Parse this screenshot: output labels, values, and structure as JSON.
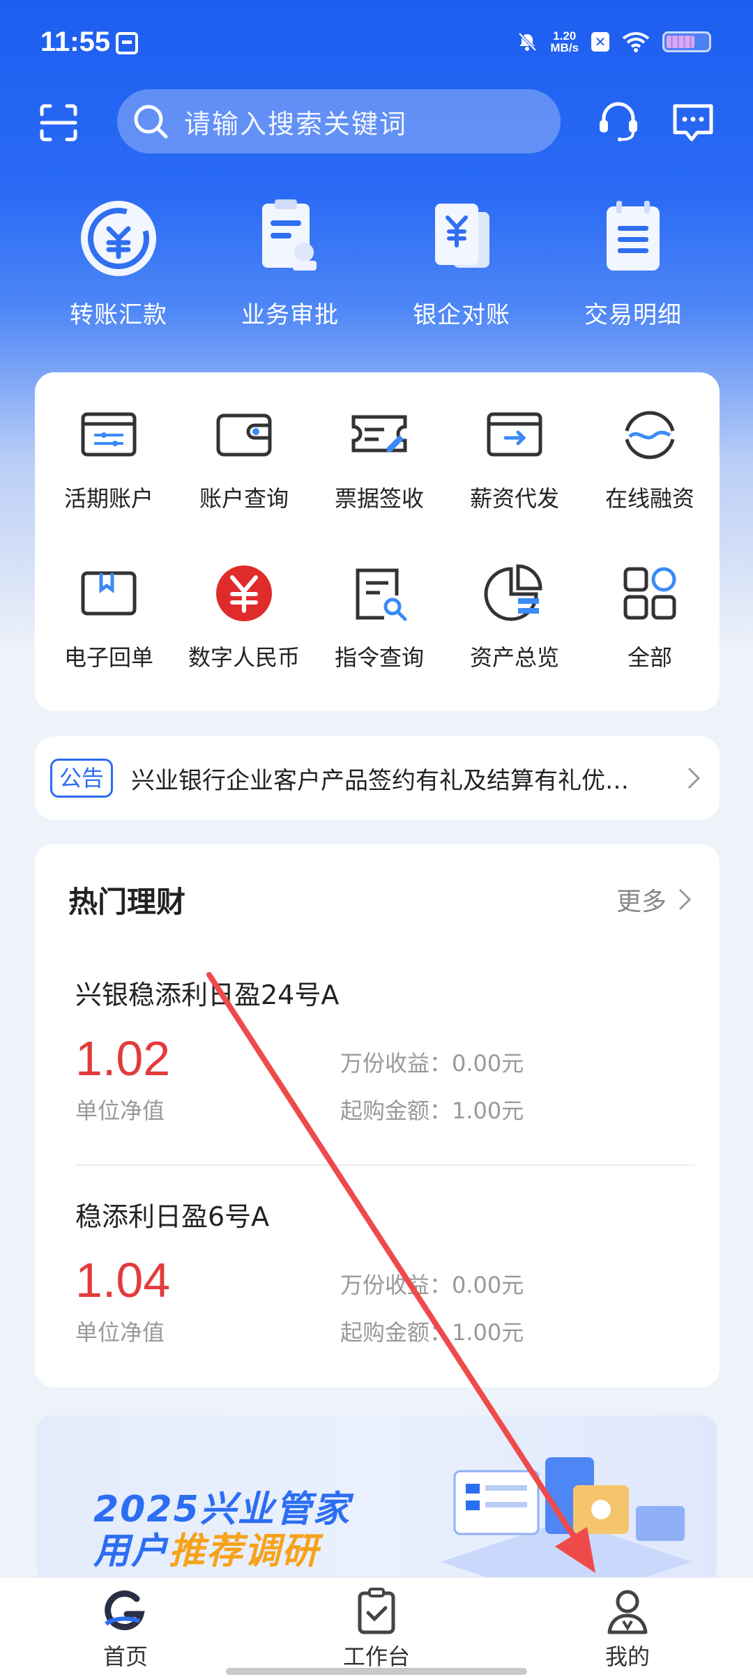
{
  "status_bar": {
    "time": "11:55",
    "net_speed_value": "1.20",
    "net_speed_unit": "MB/s",
    "icons": [
      "sim-card-icon",
      "mute-bell-icon",
      "x-app-icon",
      "wifi-icon",
      "battery-icon"
    ]
  },
  "header": {
    "search_placeholder": "请输入搜索关键词",
    "icons": [
      "scan-icon",
      "search-icon",
      "customer-service-icon",
      "message-icon"
    ]
  },
  "quick_actions": [
    {
      "label": "转账汇款",
      "icon": "transfer-icon"
    },
    {
      "label": "业务审批",
      "icon": "approval-icon"
    },
    {
      "label": "银企对账",
      "icon": "reconciliation-icon"
    },
    {
      "label": "交易明细",
      "icon": "transaction-detail-icon"
    }
  ],
  "services": [
    {
      "label": "活期账户",
      "icon": "current-account-icon"
    },
    {
      "label": "账户查询",
      "icon": "wallet-icon"
    },
    {
      "label": "票据签收",
      "icon": "bill-sign-icon"
    },
    {
      "label": "薪资代发",
      "icon": "payroll-icon"
    },
    {
      "label": "在线融资",
      "icon": "financing-icon"
    },
    {
      "label": "电子回单",
      "icon": "e-receipt-icon"
    },
    {
      "label": "数字人民币",
      "icon": "digital-rmb-icon"
    },
    {
      "label": "指令查询",
      "icon": "instruction-query-icon"
    },
    {
      "label": "资产总览",
      "icon": "asset-overview-icon"
    },
    {
      "label": "全部",
      "icon": "all-apps-icon"
    }
  ],
  "notice": {
    "badge": "公告",
    "text": "兴业银行企业客户产品签约有礼及结算有礼优…"
  },
  "wealth": {
    "title": "热门理财",
    "more": "更多",
    "products": [
      {
        "name": "兴银稳添利日盈24号A",
        "rate": "1.02",
        "rate_label": "单位净值",
        "gain": "万份收益：0.00元",
        "min_amount": "起购金额：1.00元"
      },
      {
        "name": "稳添利日盈6号A",
        "rate": "1.04",
        "rate_label": "单位净值",
        "gain": "万份收益：0.00元",
        "min_amount": "起购金额：1.00元"
      }
    ]
  },
  "banner": {
    "line1": "2025兴业管家",
    "line2_a": "用户",
    "line2_b": "推荐调研"
  },
  "tab_bar": [
    {
      "label": "首页",
      "icon": "home-logo-icon",
      "active": true
    },
    {
      "label": "工作台",
      "icon": "workbench-icon",
      "active": false
    },
    {
      "label": "我的",
      "icon": "profile-icon",
      "active": false
    }
  ],
  "colors": {
    "brand_blue": "#1d5ef0",
    "rate_red": "#e23b3b",
    "banner_orange": "#f7a21b",
    "annotation_arrow": "#ef4a4a"
  }
}
